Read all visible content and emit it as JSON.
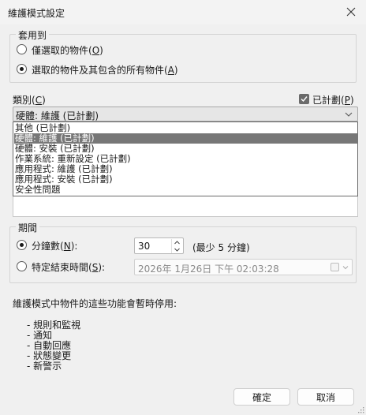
{
  "window": {
    "title": "維護模式設定"
  },
  "apply_to": {
    "legend": "套用到",
    "options": [
      {
        "label": "僅選取的物件",
        "hotkey": "O",
        "selected": false
      },
      {
        "label": "選取的物件及其包含的所有物件",
        "hotkey": "A",
        "selected": true
      }
    ]
  },
  "category": {
    "label": "類別",
    "hotkey": "C",
    "planned_label": "已計劃",
    "planned_hotkey": "P",
    "planned_checked": true,
    "selected_value": "硬體: 維護 (已計劃)",
    "options": [
      "其他 (已計劃)",
      "硬體: 維護 (已計劃)",
      "硬體: 安裝 (已計劃)",
      "作業系統: 重新設定 (已計劃)",
      "應用程式: 維護 (已計劃)",
      "應用程式: 安裝 (已計劃)",
      "安全性問題"
    ],
    "highlighted_index": 1
  },
  "duration": {
    "legend": "期間",
    "minutes_label": "分鐘數",
    "minutes_hotkey": "N",
    "minutes_value": "30",
    "minutes_hint": "(最少 5 分鐘)",
    "end_time_label": "特定結束時間",
    "end_time_hotkey": "S",
    "end_time_value": "2026年  1月26日 下午 02:03:28",
    "minutes_selected": true
  },
  "info": {
    "heading": "維護模式中物件的這些功能會暫時停用:",
    "items": [
      "- 規則和監視",
      "- 通知",
      "- 自動回應",
      "- 狀態變更",
      "- 新警示"
    ]
  },
  "buttons": {
    "ok": "確定",
    "cancel": "取消"
  },
  "colors": {
    "accent": "#777777",
    "window_bg": "#f0f0f0"
  }
}
